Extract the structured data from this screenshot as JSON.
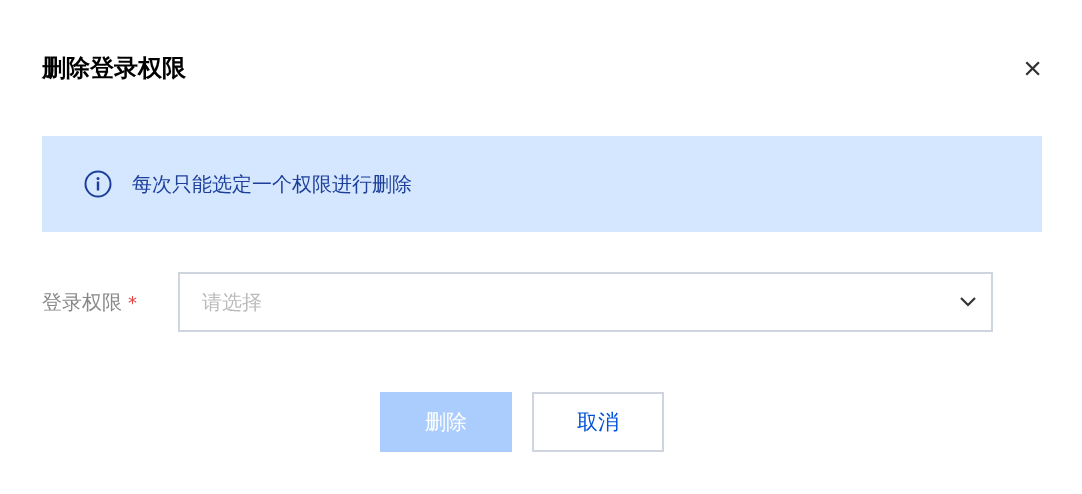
{
  "dialog": {
    "title": "删除登录权限",
    "close": "×"
  },
  "alert": {
    "text": "每次只能选定一个权限进行删除"
  },
  "field": {
    "label": "登录权限",
    "required_mark": "*",
    "placeholder": "请选择"
  },
  "buttons": [
    {
      "label": "删除",
      "kind": "primary",
      "disabled": true
    },
    {
      "label": "取消",
      "kind": "secondary",
      "disabled": false
    }
  ]
}
